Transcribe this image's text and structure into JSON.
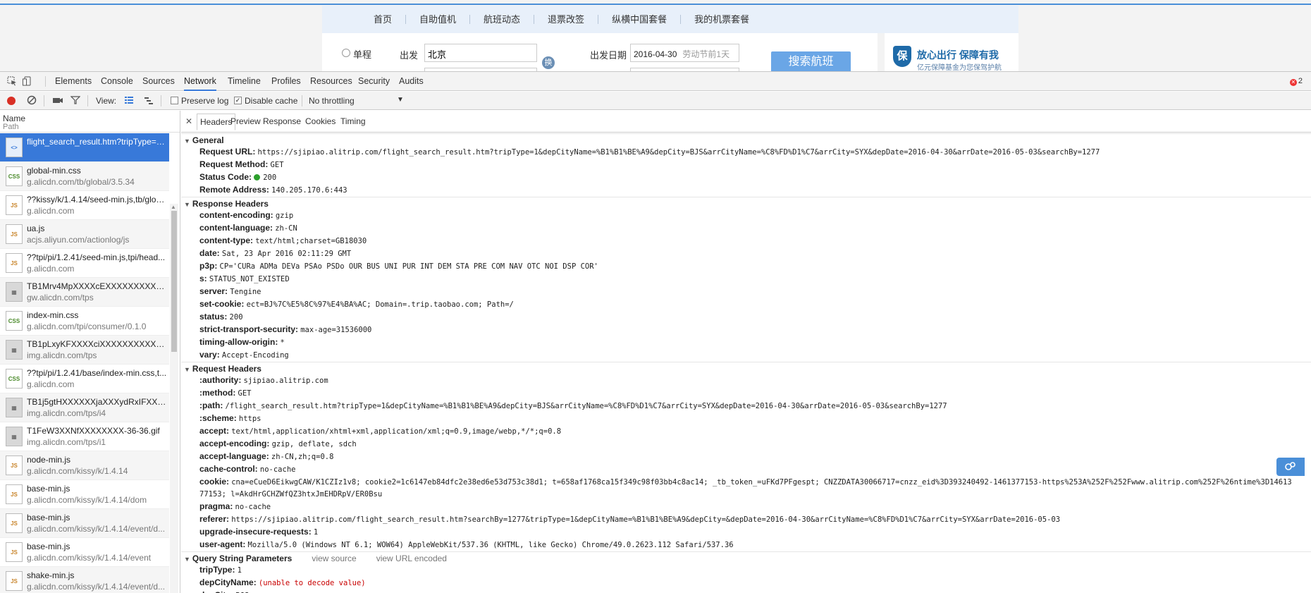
{
  "site": {
    "nav": [
      "首页",
      "自助值机",
      "航班动态",
      "退票改签",
      "纵横中国套餐",
      "我的机票套餐"
    ],
    "trip_type_label": "单程",
    "departure_label": "出发",
    "departure_value": "北京",
    "swap_label": "换",
    "date_label": "出发日期",
    "date_value": "2016-04-30",
    "date_hint": "劳动节前1天",
    "search_button": "搜索航班",
    "promo_logo": "保",
    "promo_title": "放心出行 保障有我",
    "promo_sub": "亿元保障基金为您保驾护航"
  },
  "devtools": {
    "tabs": [
      "Elements",
      "Console",
      "Sources",
      "Network",
      "Timeline",
      "Profiles",
      "Resources",
      "Security",
      "Audits"
    ],
    "active_tab": "Network",
    "error_count": "2",
    "toolbar": {
      "view_label": "View:",
      "preserve_log": "Preserve log",
      "disable_cache": "Disable cache",
      "throttling": "No throttling"
    },
    "list_header": {
      "name": "Name",
      "path": "Path"
    },
    "requests": [
      {
        "name": "flight_search_result.htm?tripType=1...",
        "path": "",
        "type": "doc",
        "icon": "document-icon"
      },
      {
        "name": "global-min.css",
        "path": "g.alicdn.com/tb/global/3.5.34",
        "type": "css",
        "icon": "css-file-icon"
      },
      {
        "name": "??kissy/k/1.4.14/seed-min.js,tb/glob...",
        "path": "g.alicdn.com",
        "type": "js",
        "icon": "js-file-icon"
      },
      {
        "name": "ua.js",
        "path": "acjs.aliyun.com/actionlog/js",
        "type": "js",
        "icon": "js-file-icon"
      },
      {
        "name": "??tpi/pi/1.2.41/seed-min.js,tpi/head...",
        "path": "g.alicdn.com",
        "type": "js",
        "icon": "js-file-icon"
      },
      {
        "name": "TB1Mrv4MpXXXXcEXXXXXXXXXXXX...",
        "path": "gw.alicdn.com/tps",
        "type": "img",
        "icon": "image-file-icon"
      },
      {
        "name": "index-min.css",
        "path": "g.alicdn.com/tpi/consumer/0.1.0",
        "type": "css",
        "icon": "css-file-icon"
      },
      {
        "name": "TB1pLxyKFXXXXciXXXXXXXXXXXX-1...",
        "path": "img.alicdn.com/tps",
        "type": "img",
        "icon": "image-file-icon"
      },
      {
        "name": "??tpi/pi/1.2.41/base/index-min.css,t...",
        "path": "g.alicdn.com",
        "type": "css",
        "icon": "css-file-icon"
      },
      {
        "name": "TB1j5gtHXXXXXXjaXXXydRxIFXX-73...",
        "path": "img.alicdn.com/tps/i4",
        "type": "img",
        "icon": "image-file-icon"
      },
      {
        "name": "T1FeW3XXNfXXXXXXXX-36-36.gif",
        "path": "img.alicdn.com/tps/i1",
        "type": "img",
        "icon": "image-file-icon"
      },
      {
        "name": "node-min.js",
        "path": "g.alicdn.com/kissy/k/1.4.14",
        "type": "js",
        "icon": "js-file-icon"
      },
      {
        "name": "base-min.js",
        "path": "g.alicdn.com/kissy/k/1.4.14/dom",
        "type": "js",
        "icon": "js-file-icon"
      },
      {
        "name": "base-min.js",
        "path": "g.alicdn.com/kissy/k/1.4.14/event/d...",
        "type": "js",
        "icon": "js-file-icon"
      },
      {
        "name": "base-min.js",
        "path": "g.alicdn.com/kissy/k/1.4.14/event",
        "type": "js",
        "icon": "js-file-icon"
      },
      {
        "name": "shake-min.js",
        "path": "g.alicdn.com/kissy/k/1.4.14/event/d...",
        "type": "js",
        "icon": "js-file-icon"
      }
    ],
    "detail_tabs": [
      "Headers",
      "Preview",
      "Response",
      "Cookies",
      "Timing"
    ],
    "active_detail_tab": "Headers",
    "general": {
      "title": "General",
      "items": [
        {
          "k": "Request URL:",
          "v": "https://sjipiao.alitrip.com/flight_search_result.htm?tripType=1&depCityName=%B1%B1%BE%A9&depCity=BJS&arrCityName=%C8%FD%D1%C7&arrCity=SYX&depDate=2016-04-30&arrDate=2016-05-03&searchBy=1277"
        },
        {
          "k": "Request Method:",
          "v": "GET"
        },
        {
          "k": "Status Code:",
          "v": "200",
          "status": true
        },
        {
          "k": "Remote Address:",
          "v": "140.205.170.6:443"
        }
      ]
    },
    "response_headers": {
      "title": "Response Headers",
      "items": [
        {
          "k": "content-encoding:",
          "v": "gzip"
        },
        {
          "k": "content-language:",
          "v": "zh-CN"
        },
        {
          "k": "content-type:",
          "v": "text/html;charset=GB18030"
        },
        {
          "k": "date:",
          "v": "Sat, 23 Apr 2016 02:11:29 GMT"
        },
        {
          "k": "p3p:",
          "v": "CP='CURa ADMa DEVa PSAo PSDo OUR BUS UNI PUR INT DEM STA PRE COM NAV OTC NOI DSP COR'"
        },
        {
          "k": "s:",
          "v": "STATUS_NOT_EXISTED"
        },
        {
          "k": "server:",
          "v": "Tengine"
        },
        {
          "k": "set-cookie:",
          "v": "ect=BJ%7C%E5%8C%97%E4%BA%AC; Domain=.trip.taobao.com; Path=/"
        },
        {
          "k": "status:",
          "v": "200"
        },
        {
          "k": "strict-transport-security:",
          "v": "max-age=31536000"
        },
        {
          "k": "timing-allow-origin:",
          "v": "*"
        },
        {
          "k": "vary:",
          "v": "Accept-Encoding"
        }
      ]
    },
    "request_headers": {
      "title": "Request Headers",
      "items": [
        {
          "k": ":authority:",
          "v": "sjipiao.alitrip.com"
        },
        {
          "k": ":method:",
          "v": "GET"
        },
        {
          "k": ":path:",
          "v": "/flight_search_result.htm?tripType=1&depCityName=%B1%B1%BE%A9&depCity=BJS&arrCityName=%C8%FD%D1%C7&arrCity=SYX&depDate=2016-04-30&arrDate=2016-05-03&searchBy=1277"
        },
        {
          "k": ":scheme:",
          "v": "https"
        },
        {
          "k": "accept:",
          "v": "text/html,application/xhtml+xml,application/xml;q=0.9,image/webp,*/*;q=0.8"
        },
        {
          "k": "accept-encoding:",
          "v": "gzip, deflate, sdch"
        },
        {
          "k": "accept-language:",
          "v": "zh-CN,zh;q=0.8"
        },
        {
          "k": "cache-control:",
          "v": "no-cache"
        },
        {
          "k": "cookie:",
          "v": "cna=eCueD6EikwgCAW/K1CZIz1v8; cookie2=1c6147eb84dfc2e38ed6e53d753c38d1; t=658af1768ca15f349c98f03bb4c8ac14; _tb_token_=uFKd7PFgespt; CNZZDATA30066717=cnzz_eid%3D393240492-1461377153-https%253A%252F%252Fwww.alitrip.com%252F%26ntime%3D14613 77153; l=AkdHrGCHZWfQZ3htxJmEHDRpV/ER0Bsu",
          "wrap": true
        },
        {
          "k": "pragma:",
          "v": "no-cache"
        },
        {
          "k": "referer:",
          "v": "https://sjipiao.alitrip.com/flight_search_result.htm?searchBy=1277&tripType=1&depCityName=%B1%B1%BE%A9&depCity=&depDate=2016-04-30&arrCityName=%C8%FD%D1%C7&arrCity=SYX&arrDate=2016-05-03"
        },
        {
          "k": "upgrade-insecure-requests:",
          "v": "1"
        },
        {
          "k": "user-agent:",
          "v": "Mozilla/5.0 (Windows NT 6.1; WOW64) AppleWebKit/537.36 (KHTML, like Gecko) Chrome/49.0.2623.112 Safari/537.36"
        }
      ]
    },
    "query_params": {
      "title": "Query String Parameters",
      "view_source": "view source",
      "view_url_encoded": "view URL encoded",
      "items": [
        {
          "k": "tripType:",
          "v": "1"
        },
        {
          "k": "depCityName:",
          "v": "(unable to decode value)",
          "error": true
        },
        {
          "k": "depCity:",
          "v": "BJS"
        }
      ]
    }
  }
}
